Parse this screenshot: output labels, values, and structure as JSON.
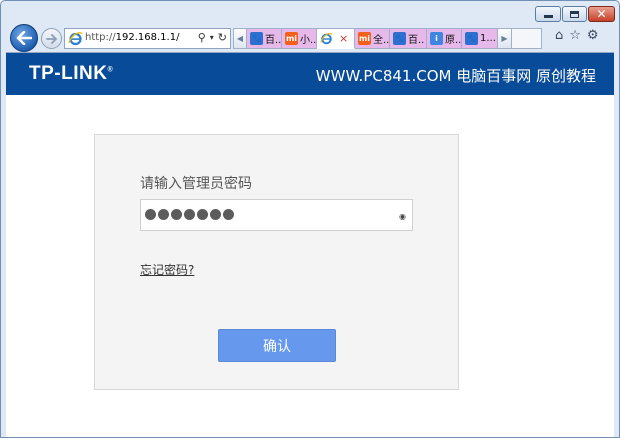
{
  "browser": {
    "address": {
      "protocol": "http://",
      "host": "192.168.1.1",
      "path": "/"
    },
    "tabs": [
      {
        "favicon": "paw-icon",
        "label": "百.."
      },
      {
        "favicon": "mi-icon",
        "label": "小.."
      },
      {
        "favicon": "ie-icon",
        "label": "",
        "active": true
      },
      {
        "favicon": "mi-icon",
        "label": "全.."
      },
      {
        "favicon": "paw-icon",
        "label": "百.."
      },
      {
        "favicon": "info-icon",
        "label": "原.."
      },
      {
        "favicon": "paw-icon",
        "label": "1..."
      }
    ],
    "close_tab_glyph": "×"
  },
  "page": {
    "brand_logo": "TP-LINK",
    "site_label": "WWW.PC841.COM 电脑百事网 原创教程",
    "password_prompt": "请输入管理员密码",
    "password_mask_count": 7,
    "forgot_password": "忘记密码?",
    "confirm_button": "确认",
    "colors": {
      "banner": "#084b99",
      "button": "#6699ee"
    }
  }
}
